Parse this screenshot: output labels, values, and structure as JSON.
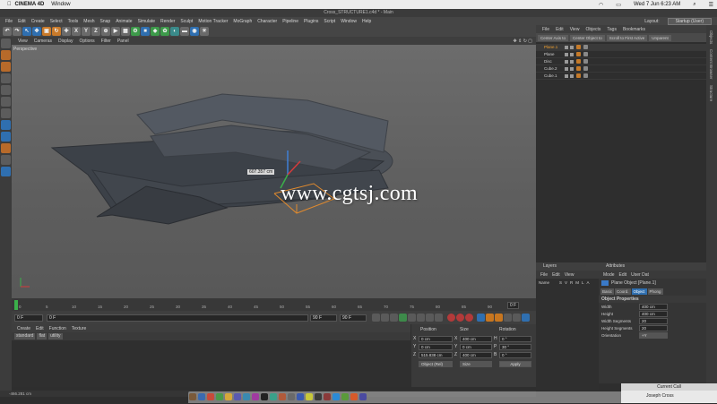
{
  "macbar": {
    "app": "CINEMA 4D",
    "menu": "Window",
    "datetime": "Wed 7 Jun  6:23 AM"
  },
  "c4d": {
    "title": "Cross_STRUCTURE1.c4d * - Main",
    "menus": [
      "File",
      "Edit",
      "Create",
      "Select",
      "Tools",
      "Mesh",
      "Snap",
      "Animate",
      "Simulate",
      "Render",
      "Sculpt",
      "Motion Tracker",
      "MoGraph",
      "Character",
      "Pipeline",
      "Plugins",
      "Script",
      "Window",
      "Help"
    ],
    "layout_label": "Layout:",
    "layout_value": "Startup (User)"
  },
  "viewport": {
    "menus": [
      "View",
      "Cameras",
      "Display",
      "Options",
      "Filter",
      "Panel"
    ],
    "label": "Perspective",
    "dimension": "607.357 cm",
    "watermark": "www.cgtsj.com"
  },
  "timeline": {
    "ticks": [
      "0",
      "5",
      "10",
      "15",
      "20",
      "25",
      "30",
      "35",
      "40",
      "45",
      "50",
      "55",
      "60",
      "65",
      "70",
      "75",
      "80",
      "85",
      "90"
    ],
    "current": "0 F",
    "start": "0 F",
    "end_a": "90 F",
    "end_b": "90 F",
    "frame_box": "0 F"
  },
  "materials": {
    "menus": [
      "Create",
      "Edit",
      "Function",
      "Texture"
    ],
    "filters": [
      "standard",
      "flat",
      "utility"
    ]
  },
  "coordinates": {
    "headers": [
      "Position",
      "Size",
      "Rotation"
    ],
    "rows": [
      {
        "axis": "X",
        "pos": "0 cm",
        "size": "400 cm",
        "rot_axis": "H",
        "rot": "0 °"
      },
      {
        "axis": "Y",
        "pos": "0 cm",
        "size": "0 cm",
        "rot_axis": "P",
        "rot": "30 °"
      },
      {
        "axis": "Z",
        "pos": "515.838 cm",
        "size": "400 cm",
        "rot_axis": "B",
        "rot": "0 °"
      }
    ],
    "mode": "Object (Rel)",
    "size_mode": "Size",
    "apply": "Apply"
  },
  "status": "-466.281 cm",
  "objects": {
    "menus": [
      "File",
      "Edit",
      "View",
      "Objects",
      "Tags",
      "Bookmarks"
    ],
    "bar": [
      "Center Axis to",
      "Center Object to",
      "Scroll to First Active",
      "Unparent"
    ],
    "items": [
      "Plane.1",
      "Plane",
      "Disc",
      "Cube.2",
      "Cube.1"
    ]
  },
  "right_tabs": [
    "Objects",
    "Content Browser",
    "Structure"
  ],
  "layers": {
    "title": "Layers",
    "menus": [
      "File",
      "Edit",
      "View"
    ],
    "columns": [
      "Name",
      "S",
      "V",
      "R",
      "M",
      "L",
      "A"
    ]
  },
  "attributes": {
    "title": "Attributes",
    "menus": [
      "Mode",
      "Edit",
      "User Dat"
    ],
    "object": "Plane Object [Plane.1]",
    "tabs": [
      "Basic",
      "Coord.",
      "Object",
      "Phong"
    ],
    "active_tab": "Object",
    "section": "Object Properties",
    "props": [
      {
        "label": "Width",
        "value": "400 cm"
      },
      {
        "label": "Height",
        "value": "400 cm"
      },
      {
        "label": "Width Segments",
        "value": "20"
      },
      {
        "label": "Height Segments",
        "value": "20"
      },
      {
        "label": "Orientation",
        "value": "+Y"
      }
    ]
  },
  "call": {
    "title": "Current Call",
    "name": "Joseph Cross"
  }
}
